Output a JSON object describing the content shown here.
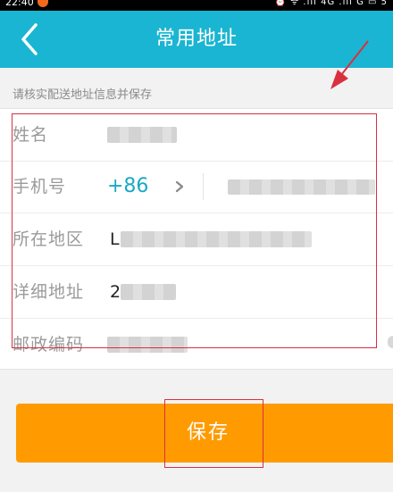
{
  "status_bar": {
    "time": "22:40",
    "icons_text": "⏰ ᯤ .ıll 4G .ıll G ▭ 5"
  },
  "header": {
    "title": "常用地址",
    "back_icon": "chevron-left-icon"
  },
  "hint": "请核实配送地址信息并保存",
  "form": {
    "name_label": "姓名",
    "phone_label": "手机号",
    "country_code": "+86",
    "region_label": "所在地区",
    "region_prefix": "L",
    "address_label": "详细地址",
    "address_prefix": "2",
    "postcode_label": "邮政编码"
  },
  "save_button": "保存",
  "colors": {
    "title_bar": "#1ab5d2",
    "accent_text": "#1aa8c7",
    "save_button": "#ff9b00",
    "annotation": "#d93040"
  }
}
